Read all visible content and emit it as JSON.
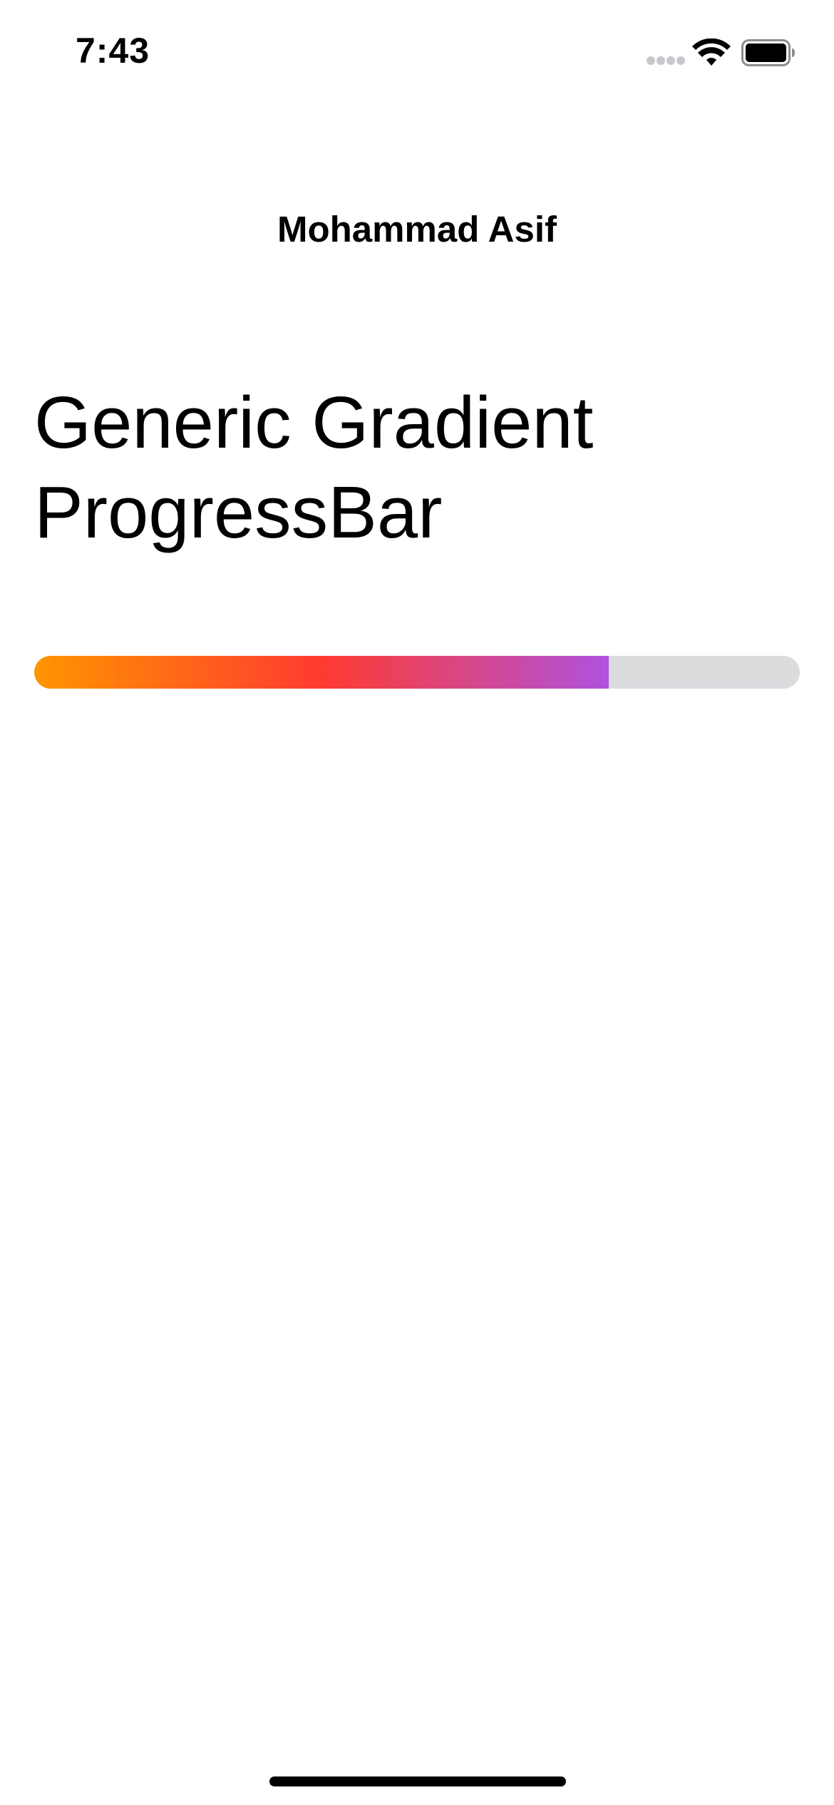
{
  "status_bar": {
    "time": "7:43",
    "signal_icon": "cellular-signal-dots-icon",
    "wifi_icon": "wifi-icon",
    "battery_icon": "battery-full-icon"
  },
  "navigation": {
    "title": "Mohammad Asif"
  },
  "content": {
    "title_line1": "Generic Gradient",
    "title_line2": "ProgressBar"
  },
  "progress": {
    "value": 0.75,
    "gradient_colors": [
      "#ff9500",
      "#ff3b30",
      "#af52de"
    ],
    "track_color": "#dcdcdf"
  }
}
